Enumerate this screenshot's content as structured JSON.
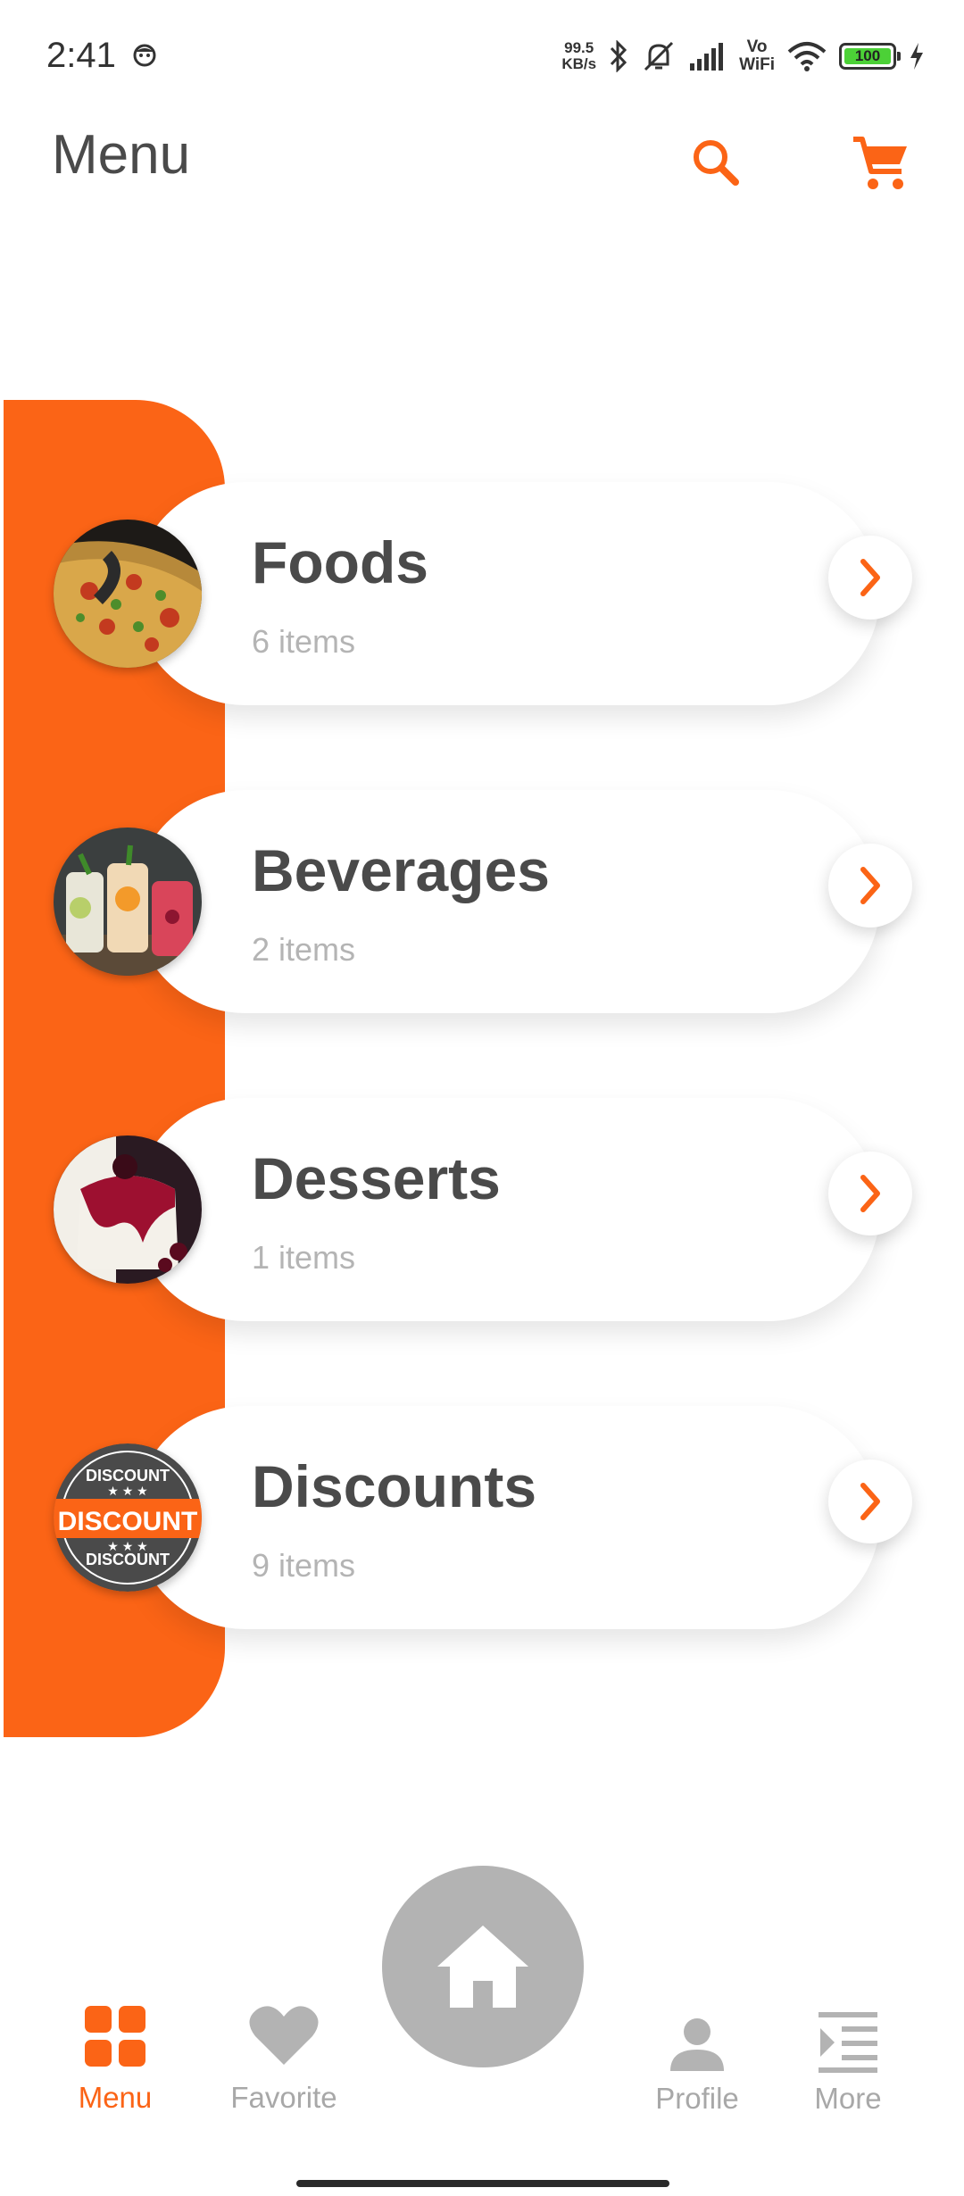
{
  "status_bar": {
    "time": "2:41",
    "net_speed_value": "99.5",
    "net_speed_unit": "KB/s",
    "vowifi_top": "Vo",
    "vowifi_bottom": "WiFi",
    "battery": "100"
  },
  "header": {
    "title": "Menu"
  },
  "categories": [
    {
      "title": "Foods",
      "count": "6 items",
      "icon": "pizza-image"
    },
    {
      "title": "Beverages",
      "count": "2 items",
      "icon": "drinks-image"
    },
    {
      "title": "Desserts",
      "count": "1 items",
      "icon": "dessert-image"
    },
    {
      "title": "Discounts",
      "count": "9 items",
      "icon": "discount-badge-image"
    }
  ],
  "discount_badge": {
    "top": "DISCOUNT",
    "middle": "DISCOUNT",
    "bottom": "DISCOUNT"
  },
  "bottom_nav": {
    "menu": "Menu",
    "favorite": "Favorite",
    "profile": "Profile",
    "more": "More"
  },
  "colors": {
    "accent": "#fb6416",
    "text": "#4a4a4a",
    "muted": "#b4b4b4",
    "inactive": "#a8a8a8"
  }
}
